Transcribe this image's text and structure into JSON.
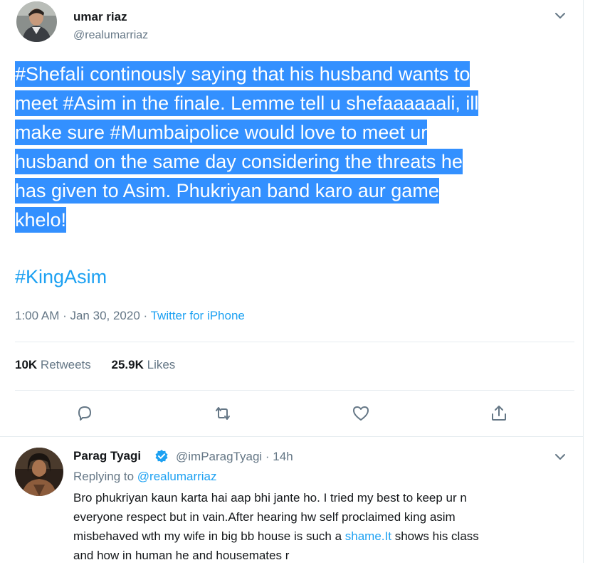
{
  "tweet": {
    "author": {
      "display_name": "umar riaz",
      "handle": "@realumarriaz"
    },
    "text_lines": [
      "#Shefali continously saying that his husband wants to ",
      "meet #Asim in the finale. Lemme tell u shefaaaaaali, ill ",
      "make sure #Mumbaipolice would love to meet ur ",
      "husband on the same  day considering the threats he ",
      "has given to Asim. Phukriyan band karo aur game ",
      "khelo! "
    ],
    "hashtag": "#KingAsim",
    "timestamp": "1:00 AM · Jan 30, 2020 · ",
    "source": "Twitter for iPhone",
    "retweets_count": "10K",
    "retweets_label": " Retweets",
    "likes_count": "25.9K",
    "likes_label": " Likes",
    "actions": [
      "reply-icon",
      "retweet-icon",
      "like-icon",
      "share-icon"
    ]
  },
  "reply": {
    "author": {
      "display_name": "Parag Tyagi",
      "handle": "@imParagTyagi · 14h",
      "verified": true
    },
    "replying_to_label": "Replying to ",
    "replying_to_handle": "@realumarriaz",
    "text_lines": [
      "Bro phukriyan kaun karta hai aap bhi jante ho. I tried my best to keep ur n",
      "everyone respect but in vain.After hearing hw self proclaimed king asim",
      "misbehaved wth my wife in big bb house is such a "
    ],
    "link_text": "shame.It",
    "text_line3_end": " shows his class",
    "text_line4": "and how in human he and housemates r"
  },
  "colors": {
    "accent": "#1da1f2",
    "selection": "#3390ff",
    "secondary_text": "#657786",
    "divider": "#e6ecf0"
  }
}
